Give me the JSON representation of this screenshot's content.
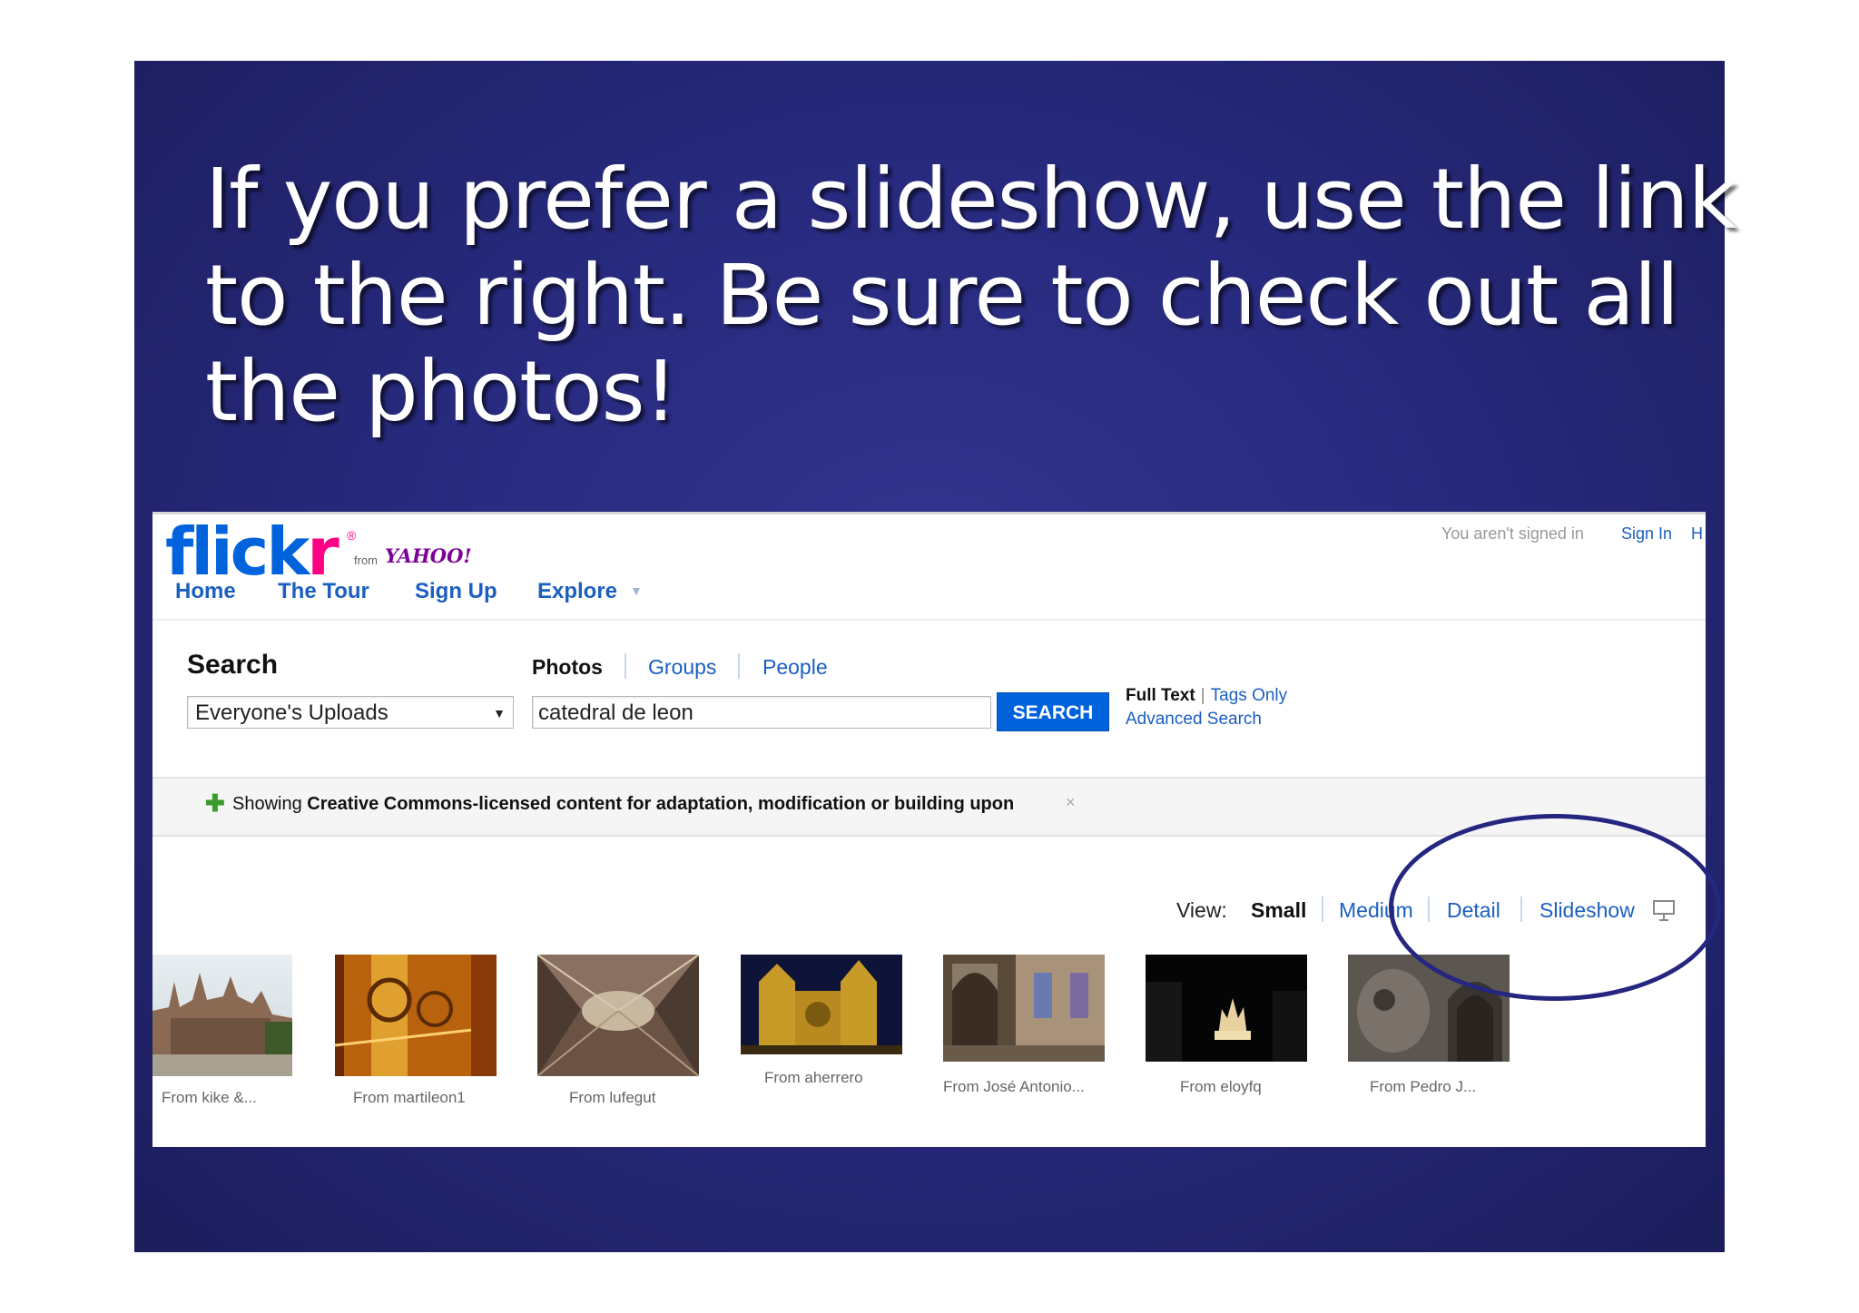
{
  "slide": {
    "headline_lines": [
      "If you prefer a slideshow, use the link",
      "to the right.  Be sure to check out all",
      "the photos!"
    ]
  },
  "flickr": {
    "logo": {
      "word": "flick",
      "r": "r",
      "reg": "®",
      "from": "from",
      "yahoo": "YAHOO!"
    },
    "nav": [
      "Home",
      "The Tour",
      "Sign Up",
      "Explore"
    ],
    "account": {
      "status": "You aren't signed in",
      "sign_in": "Sign In",
      "help_partial": "H"
    },
    "search": {
      "title": "Search",
      "tabs": [
        "Photos",
        "Groups",
        "People"
      ],
      "active_tab": "Photos",
      "scope_value": "Everyone's Uploads",
      "query_value": "catedral de leon",
      "button": "SEARCH",
      "full_text": "Full Text",
      "tags_only": "Tags Only",
      "advanced": "Advanced Search"
    },
    "cc_notice": {
      "prefix": "Showing ",
      "bold": "Creative Commons-licensed content for adaptation, modification or building upon",
      "close": "×"
    },
    "view": {
      "label": "View:",
      "selected": "Small",
      "options": [
        "Medium",
        "Detail",
        "Slideshow"
      ]
    },
    "photos": [
      {
        "caption": "From kike &..."
      },
      {
        "caption": "From martileon1"
      },
      {
        "caption": "From lufegut"
      },
      {
        "caption": "From aherrero"
      },
      {
        "caption": "From José Antonio..."
      },
      {
        "caption": "From eloyfq"
      },
      {
        "caption": "From Pedro J..."
      }
    ]
  },
  "colors": {
    "slide_bg": "#272a7e",
    "flickr_blue": "#0063dc",
    "flickr_pink": "#ff0084",
    "link_blue": "#1b5fbf",
    "circle": "#25267f"
  }
}
